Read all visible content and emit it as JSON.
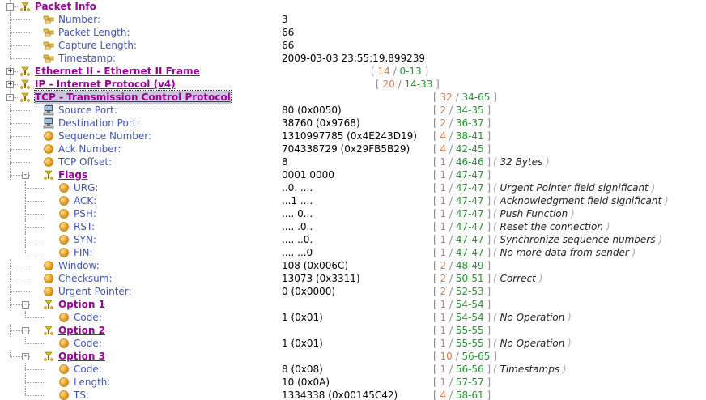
{
  "rows": [
    {
      "depth": 0,
      "kind": "group",
      "expand": "-",
      "icon": "gear-tree-icon",
      "label": "Packet Info"
    },
    {
      "depth": 1,
      "kind": "field",
      "icon": "property-icon",
      "label": "Number:",
      "value": "3"
    },
    {
      "depth": 1,
      "kind": "field",
      "icon": "property-icon",
      "label": "Packet Length:",
      "value": "66"
    },
    {
      "depth": 1,
      "kind": "field",
      "icon": "property-icon",
      "label": "Capture Length:",
      "value": "66"
    },
    {
      "depth": 1,
      "kind": "field",
      "icon": "property-icon",
      "label": "Timestamp:",
      "value": "2009-03-03 23:55:19.899239",
      "last": true
    },
    {
      "depth": 0,
      "kind": "group",
      "expand": "+",
      "icon": "gear-tree-icon",
      "label": "Ethernet II - Ethernet II Frame",
      "size": "14",
      "offset": "0-13",
      "rngcol": "eth"
    },
    {
      "depth": 0,
      "kind": "group",
      "expand": "+",
      "icon": "gear-tree-icon",
      "label": "IP - Internet Protocol (v4)",
      "size": "20",
      "offset": "14-33",
      "rngcol": "ip"
    },
    {
      "depth": 0,
      "kind": "group",
      "expand": "-",
      "icon": "gear-tree-icon",
      "label": "TCP - Transmission Control Protocol",
      "size": "32",
      "offset": "34-65",
      "selected": true,
      "last": true
    },
    {
      "depth": 1,
      "kind": "field",
      "icon": "computer-icon",
      "label": "Source Port:",
      "value": "80 (0x0050)",
      "size": "2",
      "offset": "34-35"
    },
    {
      "depth": 1,
      "kind": "field",
      "icon": "computer-icon",
      "label": "Destination Port:",
      "value": "38760 (0x9768)",
      "size": "2",
      "offset": "36-37"
    },
    {
      "depth": 1,
      "kind": "field",
      "icon": "orange-dot-icon",
      "label": "Sequence Number:",
      "value": "1310997785 (0x4E243D19)",
      "size": "4",
      "offset": "38-41"
    },
    {
      "depth": 1,
      "kind": "field",
      "icon": "orange-dot-icon",
      "label": "Ack Number:",
      "value": "704338729 (0x29FB5B29)",
      "size": "4",
      "offset": "42-45"
    },
    {
      "depth": 1,
      "kind": "field",
      "icon": "orange-dot-icon",
      "label": "TCP Offset:",
      "value": "8",
      "size": "1",
      "offset": "46-46",
      "desc": "32 Bytes"
    },
    {
      "depth": 1,
      "kind": "group",
      "expand": "-",
      "icon": "gear-tree-icon",
      "label": "Flags",
      "value": "0001 0000",
      "size": "1",
      "offset": "47-47"
    },
    {
      "depth": 2,
      "kind": "field",
      "icon": "orange-dot-icon",
      "label": "URG:",
      "value": "..0. ....",
      "size": "1",
      "offset": "47-47",
      "desc": "Urgent Pointer field significant"
    },
    {
      "depth": 2,
      "kind": "field",
      "icon": "orange-dot-icon",
      "label": "ACK:",
      "value": "...1 ....",
      "size": "1",
      "offset": "47-47",
      "desc": "Acknowledgment field significant"
    },
    {
      "depth": 2,
      "kind": "field",
      "icon": "orange-dot-icon",
      "label": "PSH:",
      "value": ".... 0...",
      "size": "1",
      "offset": "47-47",
      "desc": "Push Function"
    },
    {
      "depth": 2,
      "kind": "field",
      "icon": "orange-dot-icon",
      "label": "RST:",
      "value": ".... .0..",
      "size": "1",
      "offset": "47-47",
      "desc": "Reset the connection"
    },
    {
      "depth": 2,
      "kind": "field",
      "icon": "orange-dot-icon",
      "label": "SYN:",
      "value": ".... ..0.",
      "size": "1",
      "offset": "47-47",
      "desc": "Synchronize sequence numbers"
    },
    {
      "depth": 2,
      "kind": "field",
      "icon": "orange-dot-icon",
      "label": "FIN:",
      "value": ".... ...0",
      "size": "1",
      "offset": "47-47",
      "desc": "No more data from sender",
      "last": true
    },
    {
      "depth": 1,
      "kind": "field",
      "icon": "orange-dot-icon",
      "label": "Window:",
      "value": "108 (0x006C)",
      "size": "2",
      "offset": "48-49"
    },
    {
      "depth": 1,
      "kind": "field",
      "icon": "orange-dot-icon",
      "label": "Checksum:",
      "value": "13073 (0x3311)",
      "size": "2",
      "offset": "50-51",
      "desc": "Correct"
    },
    {
      "depth": 1,
      "kind": "field",
      "icon": "orange-dot-icon",
      "label": "Urgent Pointer:",
      "value": "0 (0x0000)",
      "size": "2",
      "offset": "52-53"
    },
    {
      "depth": 1,
      "kind": "group",
      "expand": "-",
      "icon": "gear-tree-icon",
      "label": "Option 1",
      "size": "1",
      "offset": "54-54"
    },
    {
      "depth": 2,
      "kind": "field",
      "icon": "orange-dot-icon",
      "label": "Code:",
      "value": "1 (0x01)",
      "size": "1",
      "offset": "54-54",
      "desc": "No Operation",
      "last": true
    },
    {
      "depth": 1,
      "kind": "group",
      "expand": "-",
      "icon": "gear-tree-icon",
      "label": "Option 2",
      "size": "1",
      "offset": "55-55"
    },
    {
      "depth": 2,
      "kind": "field",
      "icon": "orange-dot-icon",
      "label": "Code:",
      "value": "1 (0x01)",
      "size": "1",
      "offset": "55-55",
      "desc": "No Operation",
      "last": true
    },
    {
      "depth": 1,
      "kind": "group",
      "expand": "-",
      "icon": "gear-tree-icon",
      "label": "Option 3",
      "size": "10",
      "offset": "56-65"
    },
    {
      "depth": 2,
      "kind": "field",
      "icon": "orange-dot-icon",
      "label": "Code:",
      "value": "8 (0x08)",
      "size": "1",
      "offset": "56-56",
      "desc": "Timestamps"
    },
    {
      "depth": 2,
      "kind": "field",
      "icon": "orange-dot-icon",
      "label": "Length:",
      "value": "10 (0x0A)",
      "size": "1",
      "offset": "57-57"
    },
    {
      "depth": 2,
      "kind": "field",
      "icon": "orange-dot-icon",
      "label": "TS:",
      "value": "1334338 (0x00145C42)",
      "size": "4",
      "offset": "58-61"
    }
  ],
  "colors": {
    "field_label": "#3c52c6",
    "group_label": "#a0009a",
    "range_size": "#e8763a",
    "range_offset": "#1d9a2a"
  }
}
